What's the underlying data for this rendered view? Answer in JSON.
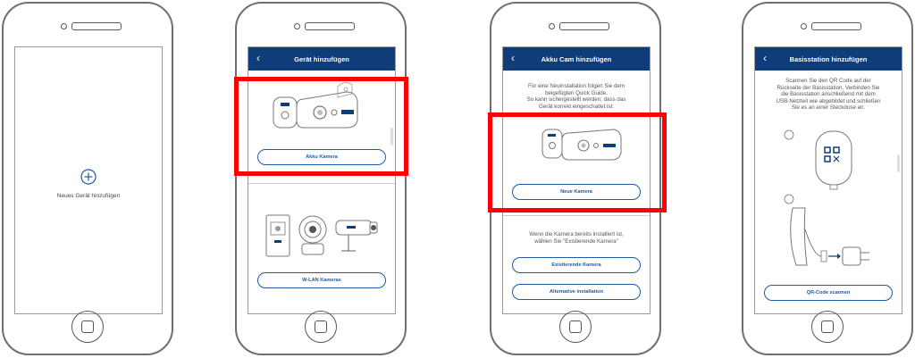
{
  "screen1": {
    "add_label": "Neues Gerät hinzufügen"
  },
  "screen2": {
    "title": "Gerät hinzufügen",
    "btn_akku": "Akku Kamera",
    "btn_wlan": "W-LAN Kameras"
  },
  "screen3": {
    "title": "Akku Cam hinzufügen",
    "intro": [
      "Für eine Neuinstallation folgen Sie dem",
      "beigefügten Quick Guide.",
      "So kann sichergestellt werden, dass das",
      "Gerät korrekt eingeschaltet ist."
    ],
    "btn_new": "Neue Kamera",
    "note": [
      "Wenn die Kamera bereits installiert ist,",
      "wählen Sie \"Existierende Kamera\""
    ],
    "btn_existing": "Existierende Kamera",
    "btn_alt": "Alternative installation"
  },
  "screen4": {
    "title": "Basisstation hinzufügen",
    "intro": [
      "Scannen Sie den QR Code auf der",
      "Rückseite der Basisstation. Verbinden Sie",
      "die Basisstation anschließend mit dem",
      "USB-Netzteil wie abgebildet und schließen",
      "Sie es an einer Steckdose an."
    ],
    "step1": "1",
    "step2": "2",
    "btn_qr": "QR-Code scannen"
  },
  "colors": {
    "header": "#0e3d7a",
    "button": "#1f5aa6",
    "highlight": "#ff0000"
  }
}
